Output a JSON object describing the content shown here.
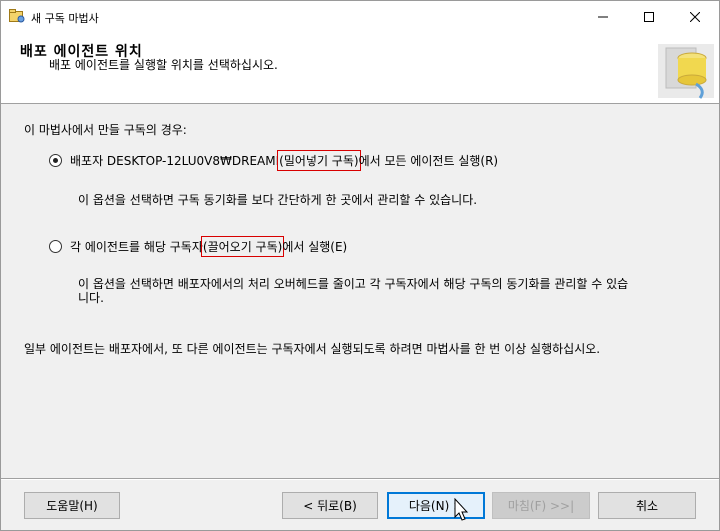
{
  "window": {
    "title": "새 구독 마법사"
  },
  "header": {
    "title": "배포 에이전트 위치",
    "subtitle": "배포 에이전트를 실행할 위치를 선택하십시오."
  },
  "main": {
    "intro": "이 마법사에서 만들 구독의 경우:",
    "option1": {
      "prefix": "배포자 DESKTOP-12LU0V8₩DREAMI",
      "highlight": "(밀어넣기 구독)",
      "suffix": "에서 모든 에이전트 실행(R)",
      "selected": true,
      "description": "이 옵션을 선택하면 구독 동기화를 보다 간단하게 한 곳에서 관리할 수 있습니다."
    },
    "option2": {
      "prefix": "각 에이전트를 해당 구독자",
      "highlight": "(끌어오기 구독)",
      "suffix": "에서 실행(E)",
      "selected": false,
      "description": "이 옵션을 선택하면 배포자에서의 처리 오버헤드를 줄이고 각 구독자에서 해당 구독의 동기화를 관리할 수 있습니다."
    },
    "note": "일부 에이전트는 배포자에서, 또 다른 에이전트는 구독자에서 실행되도록 하려면 마법사를 한 번 이상 실행하십시오."
  },
  "footer": {
    "help": "도움말(H)",
    "back": "< 뒤로(B)",
    "next": "다음(N) >",
    "finish": "마침(F) >>|",
    "cancel": "취소"
  },
  "colors": {
    "highlight_box": "#d80000",
    "focus_border": "#0078d7"
  }
}
